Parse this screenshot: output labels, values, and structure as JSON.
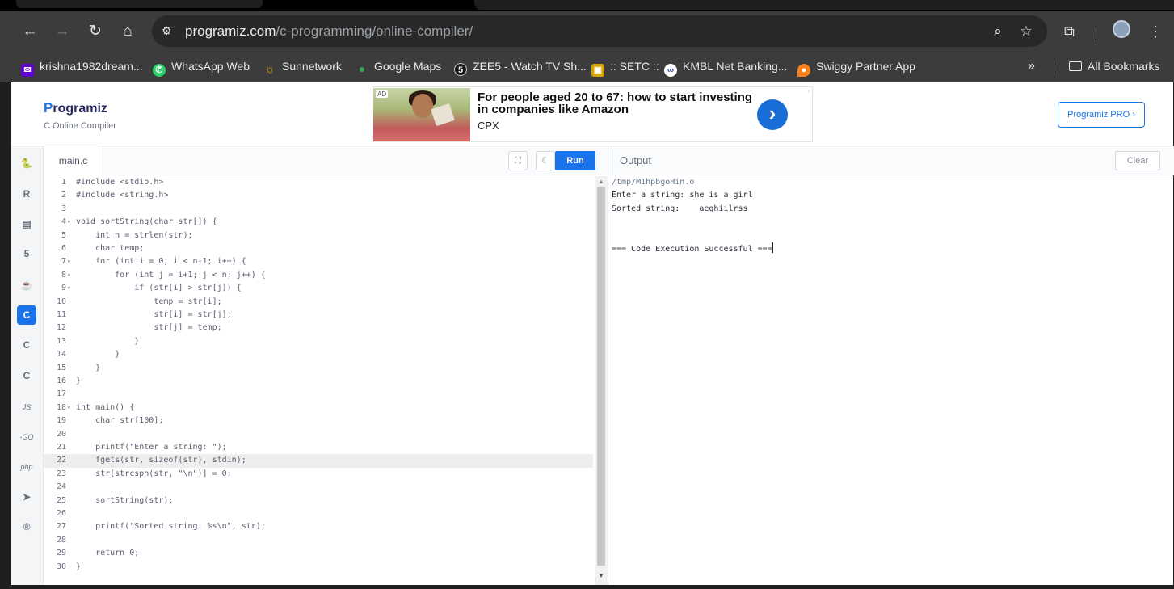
{
  "browser": {
    "url_domain": "programiz.com",
    "url_path": "/c-programming/online-compiler/",
    "bookmarks": [
      {
        "label": "krishna1982dream...",
        "icon": "yahoo-mail-icon",
        "color": "#6001d2"
      },
      {
        "label": "WhatsApp Web",
        "icon": "whatsapp-icon",
        "color": "#25d366"
      },
      {
        "label": "Sunnetwork",
        "icon": "sun-icon",
        "color": "#f5a400"
      },
      {
        "label": "Google Maps",
        "icon": "maps-pin-icon",
        "color": "#34a853"
      },
      {
        "label": "ZEE5 - Watch TV Sh...",
        "icon": "zee5-icon",
        "color": "#111111"
      },
      {
        "label": ":: SETC ::",
        "icon": "setc-icon",
        "color": "#d8a300"
      },
      {
        "label": "KMBL Net Banking...",
        "icon": "kotak-icon",
        "color": "#1d3a8a"
      },
      {
        "label": "Swiggy Partner App",
        "icon": "swiggy-icon",
        "color": "#fc8019"
      }
    ],
    "more_bookmarks": "»",
    "all_bookmarks": "All Bookmarks"
  },
  "site": {
    "logo_letter": "P",
    "logo_rest": "rogramiz",
    "subtitle": "C Online Compiler",
    "pro_button": "Programiz PRO ›"
  },
  "ad": {
    "badge": "AD",
    "title": "For people aged 20 to 67: how to start investing in companies like Amazon",
    "sponsor": "CPX"
  },
  "editor": {
    "file_tab": "main.c",
    "run_label": "Run",
    "highlighted_line": 22,
    "lines": [
      {
        "n": "1",
        "fold": "",
        "text": "#include <stdio.h>"
      },
      {
        "n": "2",
        "fold": "",
        "text": "#include <string.h>"
      },
      {
        "n": "3",
        "fold": "",
        "text": ""
      },
      {
        "n": "4",
        "fold": "▾",
        "text": "void sortString(char str[]) {"
      },
      {
        "n": "5",
        "fold": "",
        "text": "    int n = strlen(str);"
      },
      {
        "n": "6",
        "fold": "",
        "text": "    char temp;"
      },
      {
        "n": "7",
        "fold": "▾",
        "text": "    for (int i = 0; i < n-1; i++) {"
      },
      {
        "n": "8",
        "fold": "▾",
        "text": "        for (int j = i+1; j < n; j++) {"
      },
      {
        "n": "9",
        "fold": "▾",
        "text": "            if (str[i] > str[j]) {"
      },
      {
        "n": "10",
        "fold": "",
        "text": "                temp = str[i];"
      },
      {
        "n": "11",
        "fold": "",
        "text": "                str[i] = str[j];"
      },
      {
        "n": "12",
        "fold": "",
        "text": "                str[j] = temp;"
      },
      {
        "n": "13",
        "fold": "",
        "text": "            }"
      },
      {
        "n": "14",
        "fold": "",
        "text": "        }"
      },
      {
        "n": "15",
        "fold": "",
        "text": "    }"
      },
      {
        "n": "16",
        "fold": "",
        "text": "}"
      },
      {
        "n": "17",
        "fold": "",
        "text": ""
      },
      {
        "n": "18",
        "fold": "▾",
        "text": "int main() {"
      },
      {
        "n": "19",
        "fold": "",
        "text": "    char str[100];"
      },
      {
        "n": "20",
        "fold": "",
        "text": ""
      },
      {
        "n": "21",
        "fold": "",
        "text": "    printf(\"Enter a string: \");"
      },
      {
        "n": "22",
        "fold": "",
        "text": "    fgets(str, sizeof(str), stdin);"
      },
      {
        "n": "23",
        "fold": "",
        "text": "    str[strcspn(str, \"\\n\")] = 0;"
      },
      {
        "n": "24",
        "fold": "",
        "text": ""
      },
      {
        "n": "25",
        "fold": "",
        "text": "    sortString(str);"
      },
      {
        "n": "26",
        "fold": "",
        "text": ""
      },
      {
        "n": "27",
        "fold": "",
        "text": "    printf(\"Sorted string: %s\\n\", str);"
      },
      {
        "n": "28",
        "fold": "",
        "text": ""
      },
      {
        "n": "29",
        "fold": "",
        "text": "    return 0;"
      },
      {
        "n": "30",
        "fold": "",
        "text": "}"
      }
    ]
  },
  "languages": [
    {
      "name": "python-icon",
      "glyph": "🐍"
    },
    {
      "name": "r-icon",
      "glyph": "R"
    },
    {
      "name": "sql-icon",
      "glyph": "▤"
    },
    {
      "name": "html-icon",
      "glyph": "5"
    },
    {
      "name": "java-icon",
      "glyph": "☕"
    },
    {
      "name": "c-icon",
      "glyph": "C",
      "active": true
    },
    {
      "name": "cpp-icon",
      "glyph": "C"
    },
    {
      "name": "csharp-icon",
      "glyph": "C"
    },
    {
      "name": "js-icon",
      "glyph": "JS",
      "text": true
    },
    {
      "name": "go-icon",
      "glyph": "-GO",
      "text": true
    },
    {
      "name": "php-icon",
      "glyph": "php",
      "text": true
    },
    {
      "name": "swift-icon",
      "glyph": "➤"
    },
    {
      "name": "rust-icon",
      "glyph": "®"
    }
  ],
  "output": {
    "title": "Output",
    "clear_label": "Clear",
    "lines": [
      {
        "text": "/tmp/M1hpbgoHin.o",
        "kind": "path"
      },
      {
        "text": "Enter a string: she is a girl",
        "kind": "normal"
      },
      {
        "text": "Sorted string:    aeghiilrss",
        "kind": "normal"
      },
      {
        "text": "",
        "kind": "normal"
      },
      {
        "text": "",
        "kind": "normal"
      },
      {
        "text": "=== Code Execution Successful ===",
        "kind": "normal"
      }
    ]
  }
}
